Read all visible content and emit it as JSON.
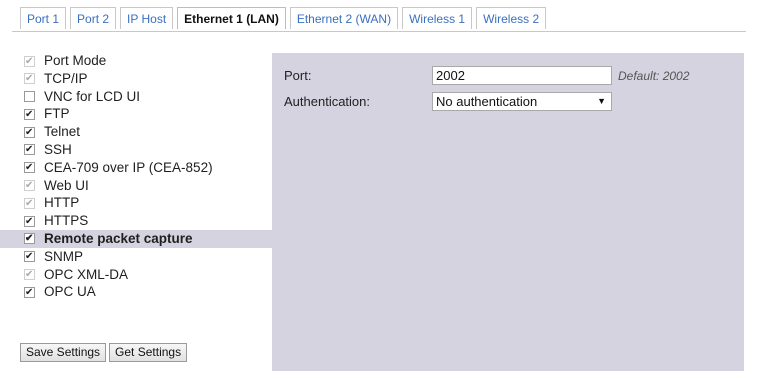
{
  "tabs": [
    {
      "label": "Port 1",
      "active": false
    },
    {
      "label": "Port 2",
      "active": false
    },
    {
      "label": "IP Host",
      "active": false
    },
    {
      "label": "Ethernet 1 (LAN)",
      "active": true
    },
    {
      "label": "Ethernet 2 (WAN)",
      "active": false
    },
    {
      "label": "Wireless 1",
      "active": false
    },
    {
      "label": "Wireless 2",
      "active": false
    }
  ],
  "sidebar": {
    "items": [
      {
        "label": "Port Mode",
        "checked": true,
        "disabled": true
      },
      {
        "label": "TCP/IP",
        "checked": true,
        "disabled": true
      },
      {
        "label": "VNC for LCD UI",
        "checked": false,
        "disabled": false
      },
      {
        "label": "FTP",
        "checked": true,
        "disabled": false
      },
      {
        "label": "Telnet",
        "checked": true,
        "disabled": false
      },
      {
        "label": "SSH",
        "checked": true,
        "disabled": false
      },
      {
        "label": "CEA-709 over IP (CEA-852)",
        "checked": true,
        "disabled": false
      },
      {
        "label": "Web UI",
        "checked": true,
        "disabled": true
      },
      {
        "label": "HTTP",
        "checked": true,
        "disabled": true
      },
      {
        "label": "HTTPS",
        "checked": true,
        "disabled": false
      },
      {
        "label": "Remote packet capture",
        "checked": true,
        "disabled": false,
        "selected": true
      },
      {
        "label": "SNMP",
        "checked": true,
        "disabled": false
      },
      {
        "label": "OPC XML-DA",
        "checked": true,
        "disabled": true
      },
      {
        "label": "OPC UA",
        "checked": true,
        "disabled": false
      }
    ]
  },
  "buttons": {
    "save": "Save Settings",
    "get": "Get Settings"
  },
  "panel": {
    "port_label": "Port:",
    "port_value": "2002",
    "port_default": "Default: 2002",
    "auth_label": "Authentication:",
    "auth_value": "No authentication"
  },
  "colors": {
    "panel_bg": "#d4d3df",
    "tab_link": "#3a6fbf"
  },
  "icons": {
    "select_arrow": "dropdown-arrow-icon",
    "checkbox": "checkbox-icon"
  }
}
